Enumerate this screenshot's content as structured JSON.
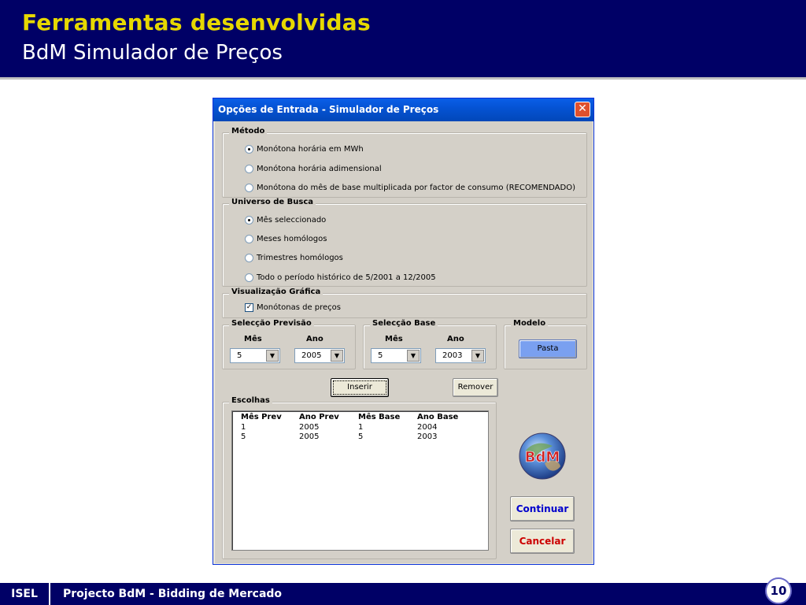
{
  "slide": {
    "title": "Ferramentas desenvolvidas",
    "subtitle": "BdM Simulador de Preços",
    "footer_org": "ISEL",
    "footer_text": "Projecto BdM - Bidding de Mercado",
    "page_number": "10"
  },
  "dialog": {
    "title": "Opções de Entrada - Simulador de Preços",
    "close_glyph": "✕",
    "metodo": {
      "legend": "Método",
      "options": [
        {
          "label": "Monótona horária em MWh",
          "selected": true
        },
        {
          "label": "Monótona horária adimensional",
          "selected": false
        },
        {
          "label": "Monótona do mês de base multiplicada por factor de consumo (RECOMENDADO)",
          "selected": false
        }
      ]
    },
    "universo": {
      "legend": "Universo de Busca",
      "options": [
        {
          "label": "Mês seleccionado",
          "selected": true
        },
        {
          "label": "Meses homólogos",
          "selected": false
        },
        {
          "label": "Trimestres homólogos",
          "selected": false
        },
        {
          "label": "Todo o período histórico de 5/2001 a 12/2005",
          "selected": false
        }
      ]
    },
    "visualizacao": {
      "legend": "Visualização Gráfica",
      "checkbox_label": "Monótonas de preços",
      "checked": true,
      "check_glyph": "✓"
    },
    "seleccao_previsao": {
      "legend": "Selecção Previsão",
      "mes_label": "Mês",
      "ano_label": "Ano",
      "mes_value": "5",
      "ano_value": "2005"
    },
    "seleccao_base": {
      "legend": "Selecção Base",
      "mes_label": "Mês",
      "ano_label": "Ano",
      "mes_value": "5",
      "ano_value": "2003"
    },
    "modelo": {
      "legend": "Modelo",
      "button_label": "Pasta"
    },
    "combo_arrow_glyph": "▼",
    "inserir_label": "Inserir",
    "remover_label": "Remover",
    "escolhas": {
      "legend": "Escolhas",
      "columns": [
        "Mês Prev",
        "Ano Prev",
        "Mês Base",
        "Ano Base"
      ],
      "rows": [
        [
          "1",
          "2005",
          "1",
          "2004"
        ],
        [
          "5",
          "2005",
          "5",
          "2003"
        ]
      ]
    },
    "logo_text": "BdM",
    "continuar_label": "Continuar",
    "cancelar_label": "Cancelar",
    "colors": {
      "continuar_text": "#0000cc",
      "cancelar_text": "#cc0000",
      "header_bg": "#000066",
      "title_yellow": "#e6d800"
    }
  }
}
